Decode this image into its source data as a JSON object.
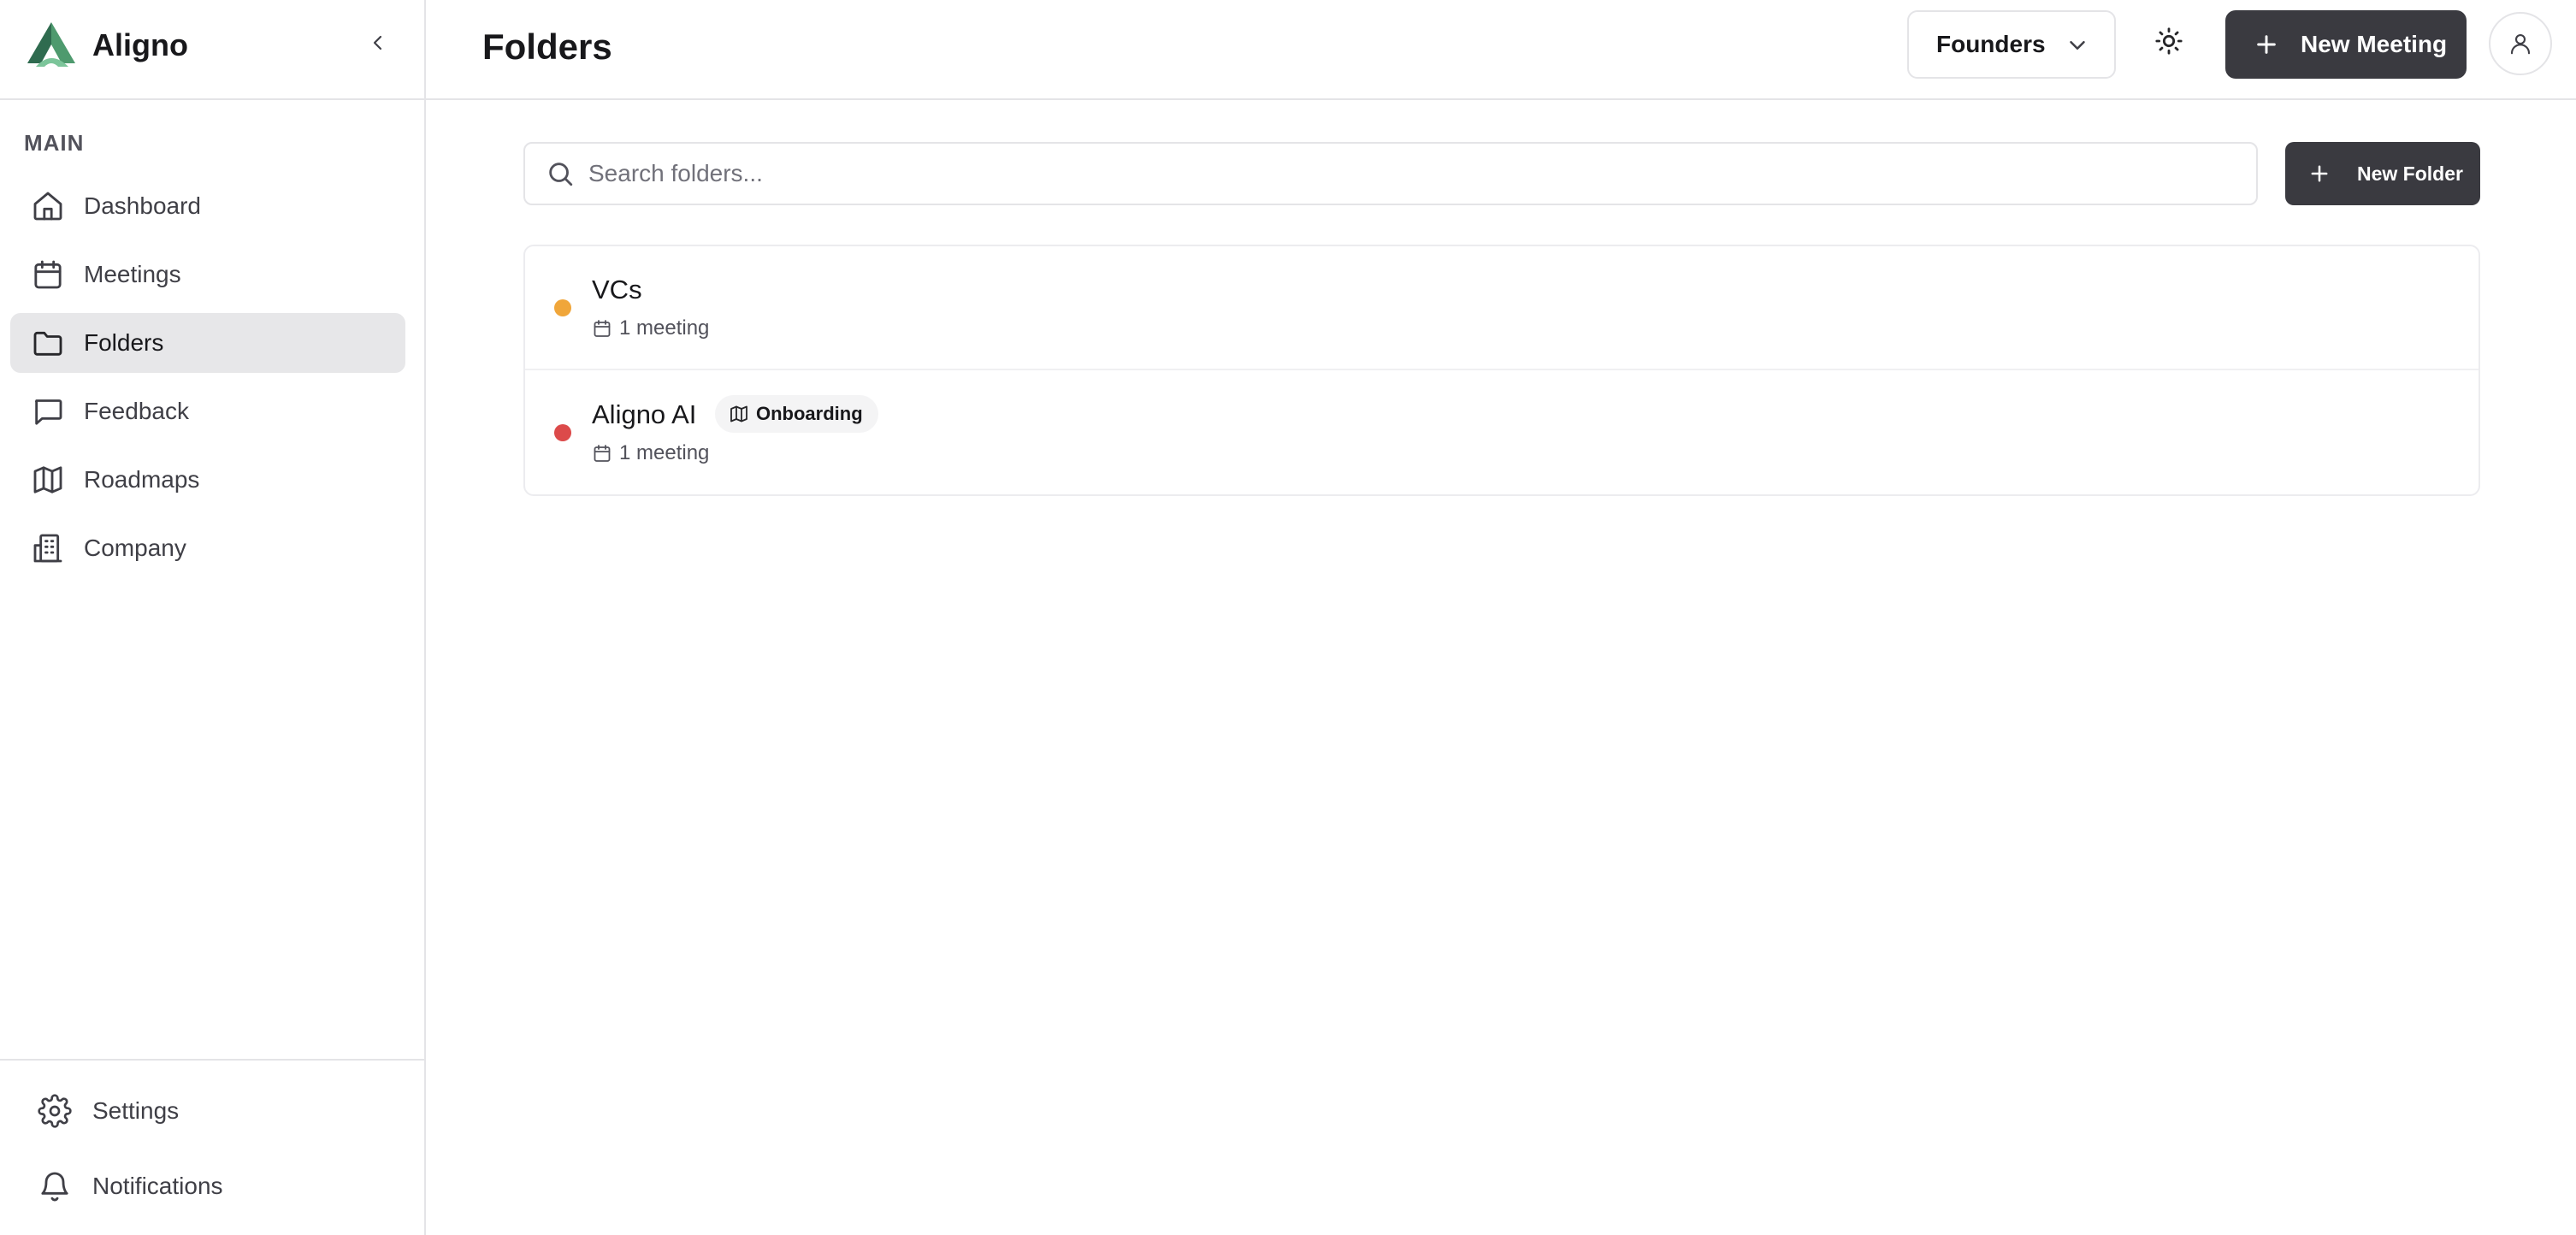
{
  "app": {
    "name": "Aligno"
  },
  "sidebar": {
    "section_label": "MAIN",
    "items": [
      {
        "label": "Dashboard",
        "icon": "home-icon"
      },
      {
        "label": "Meetings",
        "icon": "calendar-icon"
      },
      {
        "label": "Folders",
        "icon": "folder-icon",
        "active": true
      },
      {
        "label": "Feedback",
        "icon": "message-square-icon"
      },
      {
        "label": "Roadmaps",
        "icon": "map-icon"
      },
      {
        "label": "Company",
        "icon": "building-icon"
      }
    ],
    "footer": [
      {
        "label": "Settings",
        "icon": "gear-icon"
      },
      {
        "label": "Notifications",
        "icon": "bell-icon"
      }
    ]
  },
  "header": {
    "title": "Folders",
    "workspace_selected": "Founders",
    "new_meeting_label": "New Meeting"
  },
  "main": {
    "search_placeholder": "Search folders...",
    "new_folder_label": "New Folder",
    "folders": [
      {
        "name": "VCs",
        "meta": "1 meeting",
        "dot_color": "#f0a63a"
      },
      {
        "name": "Aligno AI",
        "meta": "1 meeting",
        "dot_color": "#dc4a4a",
        "tag": "Onboarding"
      }
    ]
  },
  "colors": {
    "accent_dark": "#3a3a40",
    "active_bg": "#e7e7e9",
    "logo_dark": "#2f6b4f",
    "logo_light": "#5fae7f"
  }
}
